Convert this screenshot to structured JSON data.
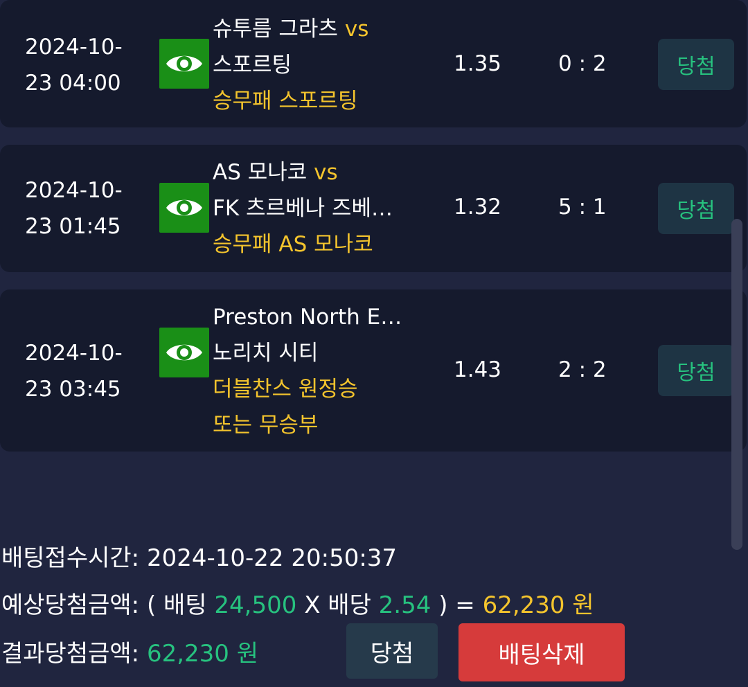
{
  "bets": [
    {
      "date_line1": "2024-10-",
      "date_line2": "23 04:00",
      "home": "슈투름 그라츠",
      "vs": "vs",
      "away": "스포르팅",
      "pick": "승무패 스포르팅",
      "odds": "1.35",
      "score": "0 : 2",
      "status": "당첨"
    },
    {
      "date_line1": "2024-10-",
      "date_line2": "23 01:45",
      "home": "AS 모나코",
      "vs": "vs",
      "away": "FK 츠르베나 즈베…",
      "pick": "승무패 AS 모나코",
      "odds": "1.32",
      "score": "5 : 1",
      "status": "당첨"
    },
    {
      "date_line1": "2024-10-",
      "date_line2": "23 03:45",
      "home": "Preston North E…",
      "vs": "",
      "away": "노리치 시티",
      "pick_line1": "더블찬스 원정승",
      "pick_line2": "또는 무승부",
      "odds": "1.43",
      "score": "2 : 2",
      "status": "당첨"
    }
  ],
  "summary": {
    "time_label": "배팅접수시간:",
    "time_value": "2024-10-22 20:50:37",
    "expected_label": "예상당첨금액:",
    "open_paren": "( 배팅",
    "stake": "24,500",
    "times": "X 배당",
    "total_odds": "2.54",
    "close_eq": ") =",
    "expected_amount": "62,230 원",
    "result_label": "결과당첨금액:",
    "result_amount": "62,230 원"
  },
  "buttons": {
    "win_label": "당첨",
    "delete_label": "배팅삭제"
  },
  "colors": {
    "accent_yellow": "#f4c42d",
    "accent_green": "#27c27f",
    "danger": "#d63b3b",
    "eye_green": "#1a8f17"
  }
}
